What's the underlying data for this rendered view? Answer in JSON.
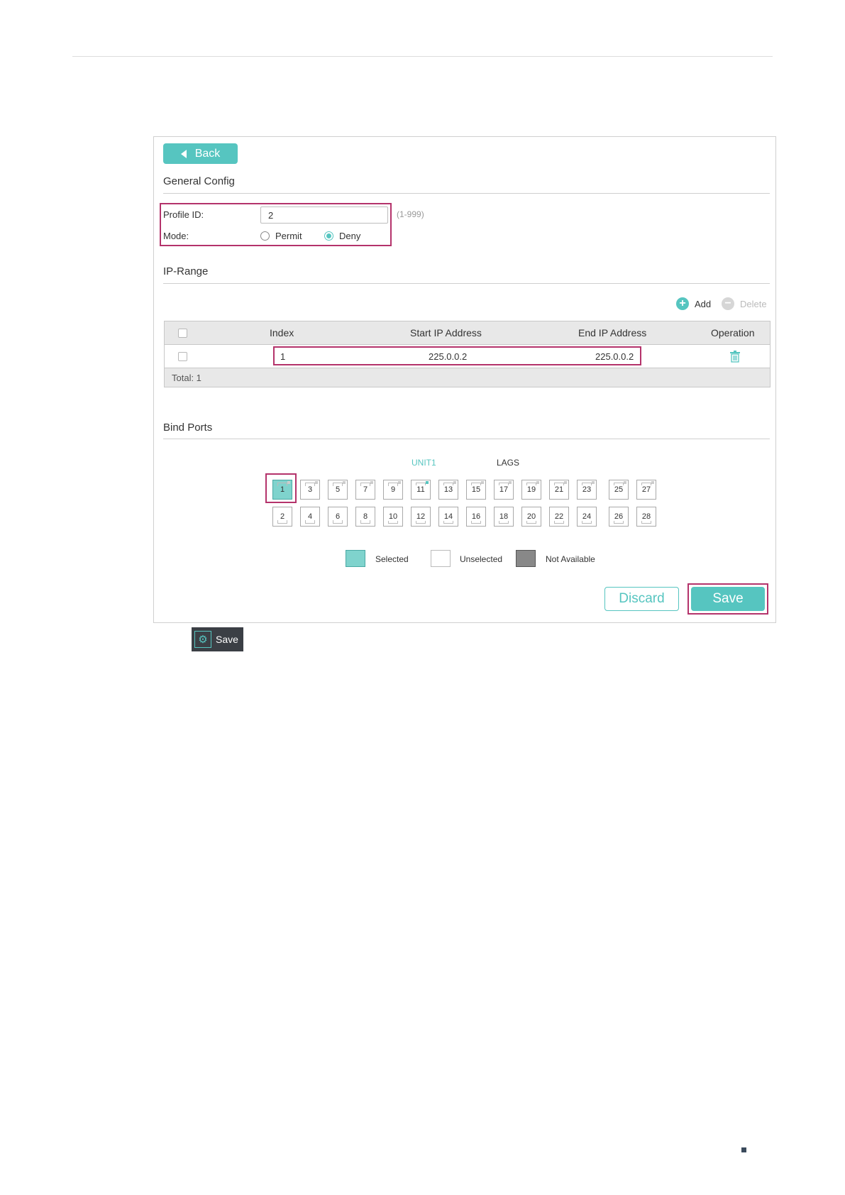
{
  "back_label": "Back",
  "general_config": {
    "title": "General Config",
    "profile_id_label": "Profile ID:",
    "profile_id_value": "2",
    "profile_id_hint": "(1-999)",
    "mode_label": "Mode:",
    "mode_options": [
      "Permit",
      "Deny"
    ],
    "mode_selected": "Deny"
  },
  "ip_range": {
    "title": "IP-Range",
    "add_label": "Add",
    "delete_label": "Delete",
    "columns": [
      "Index",
      "Start IP Address",
      "End IP Address",
      "Operation"
    ],
    "rows": [
      {
        "index": "1",
        "start_ip": "225.0.0.2",
        "end_ip": "225.0.0.2"
      }
    ],
    "total": "Total: 1"
  },
  "bind_ports": {
    "title": "Bind Ports",
    "unit_label": "UNIT1",
    "lags_label": "LAGS",
    "top_ports": [
      "1",
      "3",
      "5",
      "7",
      "9",
      "11",
      "13",
      "15",
      "17",
      "19",
      "21",
      "23",
      "25",
      "27"
    ],
    "bottom_ports": [
      "2",
      "4",
      "6",
      "8",
      "10",
      "12",
      "14",
      "16",
      "18",
      "20",
      "22",
      "24",
      "26",
      "28"
    ],
    "selected_ports": [
      "1"
    ],
    "legend": {
      "selected": "Selected",
      "unselected": "Unselected",
      "not_available": "Not Available"
    }
  },
  "actions": {
    "discard_label": "Discard",
    "save_label": "Save"
  },
  "save_chip_label": "Save",
  "colors": {
    "accent": "#56c5c0",
    "highlight": "#b4336b"
  }
}
